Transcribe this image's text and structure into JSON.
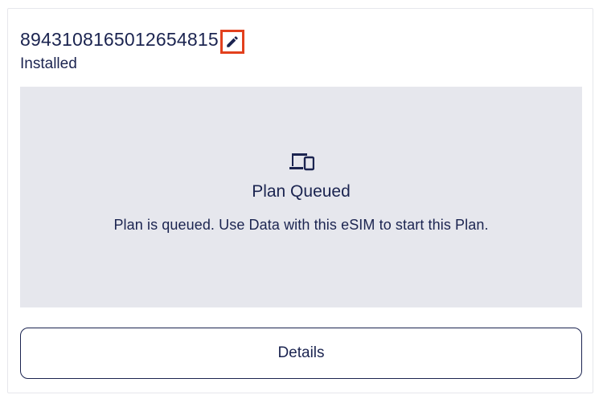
{
  "esim": {
    "iccid": "8943108165012654815",
    "status": "Installed"
  },
  "plan": {
    "icon": "devices-icon",
    "title": "Plan Queued",
    "message": "Plan is queued. Use Data with this eSIM to start this Plan."
  },
  "actions": {
    "edit_icon": "pencil-icon",
    "details_label": "Details"
  },
  "colors": {
    "text": "#1b2450",
    "panel_bg": "#e6e7ed",
    "highlight": "#e2401d"
  }
}
